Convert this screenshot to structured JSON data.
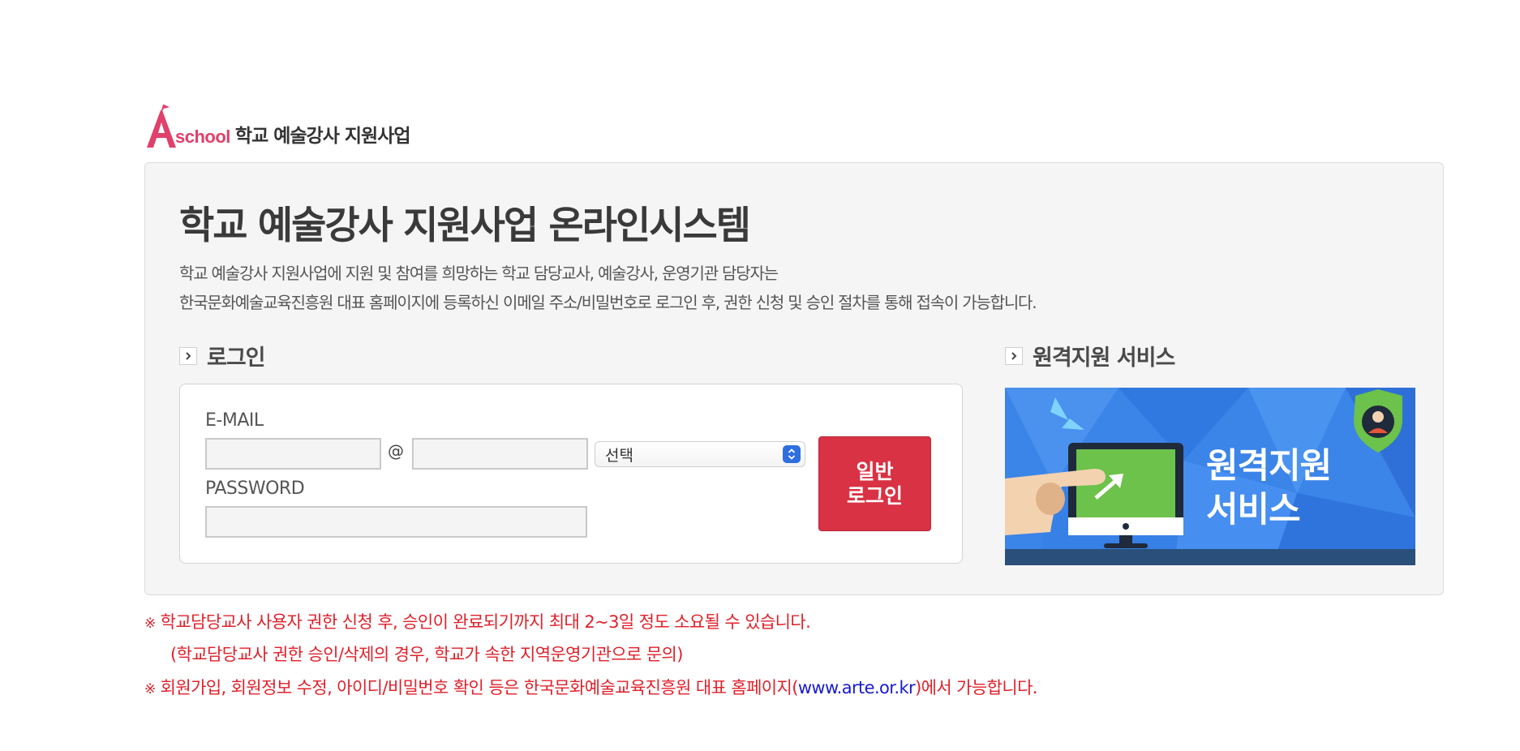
{
  "header": {
    "logo_letter": "A",
    "logo_school": "school",
    "logo_title": "학교 예술강사 지원사업"
  },
  "panel": {
    "title": "학교 예술강사 지원사업 온라인시스템",
    "desc_line1": "학교 예술강사 지원사업에 지원 및 참여를 희망하는 학교 담당교사, 예술강사, 운영기관 담당자는",
    "desc_line2": "한국문화예술교육진흥원 대표 홈페이지에 등록하신 이메일 주소/비밀번호로 로그인 후, 권한 신청 및 승인 절차를 통해 접속이 가능합니다."
  },
  "login": {
    "heading": "로그인",
    "email_label": "E-MAIL",
    "at": "@",
    "email_id_value": "",
    "email_domain_value": "",
    "domain_select_value": "선택",
    "password_label": "PASSWORD",
    "password_value": "",
    "button_line1": "일반",
    "button_line2": "로그인"
  },
  "remote": {
    "heading": "원격지원 서비스",
    "banner_line1": "원격지원",
    "banner_line2": "서비스"
  },
  "notices": {
    "mark": "※",
    "line1": "학교담당교사 사용자 권한 신청 후, 승인이 완료되기까지 최대 2~3일 정도 소요될 수 있습니다.",
    "line2": "(학교담당교사 권한 승인/삭제의 경우, 학교가 속한 지역운영기관으로 문의)",
    "line3_pre": "회원가입, 회원정보 수정, 아이디/비밀번호 확인 등은 한국문화예술교육진흥원 대표 홈페이지(",
    "line3_link": "www.arte.or.kr",
    "line3_post": ")에서 가능합니다."
  },
  "colors": {
    "accent_red": "#d93245",
    "notice_red": "#e0202a",
    "link_blue": "#1a1ad0",
    "banner_blue": "#3b84e8",
    "logo_pink": "#e0406a"
  }
}
